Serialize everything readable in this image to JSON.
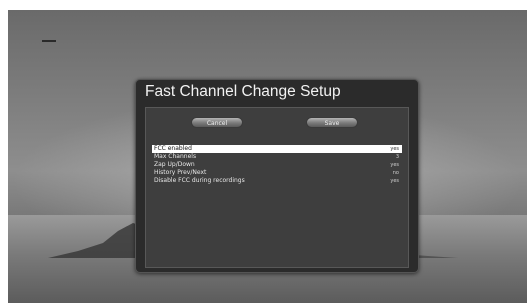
{
  "dialog": {
    "title": "Fast Channel Change Setup",
    "cancel_label": "Cancel",
    "save_label": "Save",
    "rows": [
      {
        "label": "FCC enabled",
        "value": "yes"
      },
      {
        "label": "Max Channels",
        "value": "3"
      },
      {
        "label": "Zap Up/Down",
        "value": "yes"
      },
      {
        "label": "History Prev/Next",
        "value": "no"
      },
      {
        "label": "Disable FCC during recordings",
        "value": "yes"
      }
    ],
    "selected_index": 0
  }
}
